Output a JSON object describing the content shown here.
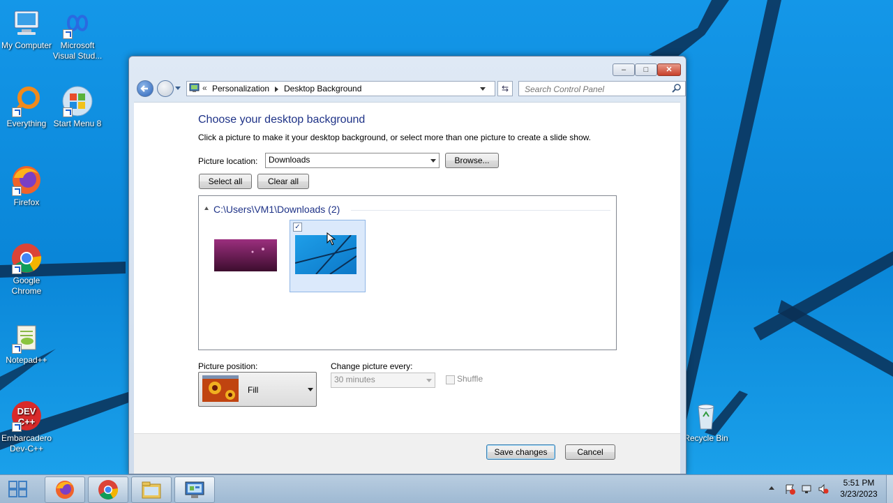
{
  "desktop": {
    "icons": [
      {
        "label": "My Computer",
        "icon": "computer-icon"
      },
      {
        "label": "Microsoft Visual Stud...",
        "icon": "visual-studio-icon"
      },
      {
        "label": "Everything",
        "icon": "everything-icon"
      },
      {
        "label": "Start Menu 8",
        "icon": "start-menu-icon"
      },
      {
        "label": "Firefox",
        "icon": "firefox-icon"
      },
      {
        "label": "Google Chrome",
        "icon": "chrome-icon"
      },
      {
        "label": "Notepad++",
        "icon": "notepad-plus-plus-icon"
      },
      {
        "label": "Embarcadero Dev-C++",
        "icon": "dev-cpp-icon"
      },
      {
        "label": "Recycle Bin",
        "icon": "recycle-bin-icon"
      }
    ]
  },
  "window": {
    "caption_buttons": {
      "minimize": "–",
      "maximize": "□",
      "close": "✕"
    },
    "nav": {
      "breadcrumb_prefix": "«",
      "crumbs": [
        "Personalization",
        "Desktop Background"
      ],
      "search_placeholder": "Search Control Panel"
    },
    "heading": "Choose your desktop background",
    "description": "Click a picture to make it your desktop background, or select more than one picture to create a slide show.",
    "picture_location_label": "Picture location:",
    "picture_location_value": "Downloads",
    "browse_label": "Browse...",
    "select_all_label": "Select all",
    "clear_all_label": "Clear all",
    "group_title": "C:\\Users\\VM1\\Downloads (2)",
    "thumbnails": [
      {
        "name": "purple-wallpaper",
        "checked": false
      },
      {
        "name": "blue-windows-wallpaper",
        "checked": true
      }
    ],
    "picture_position_label": "Picture position:",
    "picture_position_value": "Fill",
    "change_picture_label": "Change picture every:",
    "change_picture_value": "30 minutes",
    "shuffle_label": "Shuffle",
    "save_label": "Save changes",
    "cancel_label": "Cancel"
  },
  "taskbar": {
    "items": [
      "start-button",
      "firefox",
      "chrome",
      "file-explorer",
      "control-panel"
    ],
    "clock_time": "5:51 PM",
    "clock_date": "3/23/2023"
  }
}
